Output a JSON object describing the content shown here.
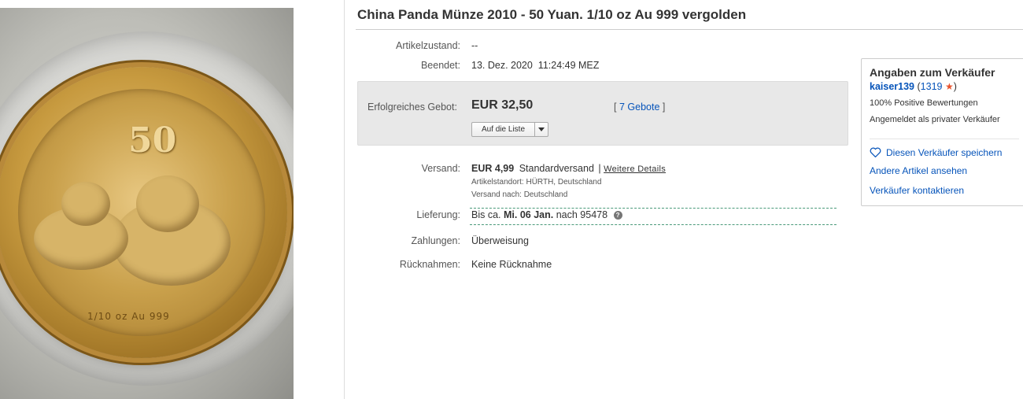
{
  "image": {
    "coin_value": "50",
    "coin_legend": "1/10 oz Au 999"
  },
  "listing": {
    "title": "China Panda Münze 2010 - 50 Yuan. 1/10 oz Au 999 vergolden",
    "condition_label": "Artikelzustand:",
    "condition_value": "--",
    "ended_label": "Beendet:",
    "ended_date": "13. Dez. 2020",
    "ended_time": "11:24:49 MEZ",
    "bid_label": "Erfolgreiches Gebot:",
    "bid_price": "EUR 32,50",
    "bids_open": "[",
    "bids_link": "7 Gebote",
    "bids_close": "]",
    "watch_label": "Auf die Liste",
    "shipping_label": "Versand:",
    "shipping_price": "EUR 4,99",
    "shipping_method": "Standardversand",
    "shipping_sep": "|",
    "shipping_details": "Weitere Details",
    "item_location": "Artikelstandort:  HÜRTH, Deutschland",
    "ships_to": "Versand nach:  Deutschland",
    "delivery_label": "Lieferung:",
    "delivery_prefix": "Bis ca.",
    "delivery_date": "Mi. 06 Jan.",
    "delivery_suffix": "nach 95478",
    "payments_label": "Zahlungen:",
    "payments_value": "Überweisung",
    "returns_label": "Rücknahmen:",
    "returns_value": "Keine Rücknahme"
  },
  "seller": {
    "title": "Angaben zum Verkäufer",
    "username": "kaiser139",
    "feedback_open": "(",
    "feedback_score": "1319",
    "feedback_close": ")",
    "positive": "100% Positive Bewertungen",
    "type": "Angemeldet als privater Verkäufer",
    "save_seller": "Diesen Verkäufer speichern",
    "other_items": "Andere Artikel ansehen",
    "contact": "Verkäufer kontaktieren"
  },
  "colors": {
    "link": "#0654ba",
    "star": "#e8542e",
    "delivery_dash": "#4a9a7a"
  }
}
